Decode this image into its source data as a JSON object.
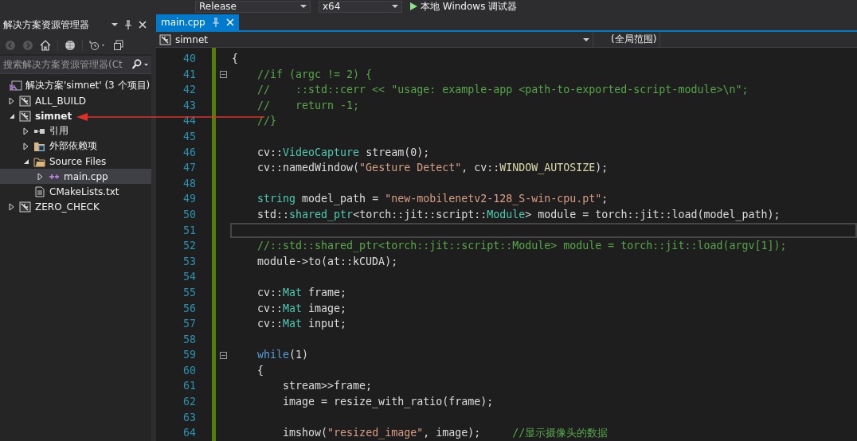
{
  "toolbar": {
    "configuration": "Release",
    "platform": "x64",
    "debugger": "本地 Windows 调试器"
  },
  "solution_explorer": {
    "title": "解决方案资源管理器",
    "search": {
      "placeholder": "搜索解决方案资源管理器(Ct"
    },
    "tree": [
      {
        "label": "解决方案'simnet' (3 个项目)",
        "kind": "solution",
        "selected": false,
        "bold": false,
        "children": [
          {
            "label": "ALL_BUILD",
            "kind": "project",
            "expanded": false,
            "selected": false,
            "bold": false
          },
          {
            "label": "simnet",
            "kind": "project",
            "expanded": true,
            "selected": false,
            "bold": true,
            "children": [
              {
                "label": "引用",
                "kind": "references",
                "expanded": false,
                "selected": false,
                "bold": false
              },
              {
                "label": "外部依赖项",
                "kind": "dependencies",
                "expanded": false,
                "selected": false,
                "bold": false
              },
              {
                "label": "Source Files",
                "kind": "filter",
                "expanded": true,
                "selected": false,
                "bold": false,
                "children": [
                  {
                    "label": "main.cpp",
                    "kind": "cpp",
                    "expanded": false,
                    "selected": true,
                    "bold": false
                  }
                ]
              },
              {
                "label": "CMakeLists.txt",
                "kind": "text",
                "selected": false,
                "bold": false
              }
            ]
          },
          {
            "label": "ZERO_CHECK",
            "kind": "project",
            "expanded": false,
            "selected": false,
            "bold": false
          }
        ]
      }
    ]
  },
  "editor": {
    "tabs": [
      {
        "label": "main.cpp",
        "selected": true
      }
    ],
    "project": "simnet",
    "scope": "(全局范围)",
    "lines": [
      {
        "number": "40",
        "current": false,
        "foldable": false,
        "tokens": [
          {
            "kind": "plain",
            "text": "{"
          }
        ]
      },
      {
        "number": "41",
        "current": false,
        "foldable": true,
        "tokens": [
          {
            "kind": "comment",
            "text": "    //if (argc != 2) {"
          }
        ]
      },
      {
        "number": "42",
        "current": false,
        "foldable": false,
        "tokens": [
          {
            "kind": "comment",
            "text": "    //    ::std::cerr << \"usage: example-app <path-to-exported-script-module>\\n\";"
          }
        ]
      },
      {
        "number": "43",
        "current": false,
        "foldable": false,
        "tokens": [
          {
            "kind": "comment",
            "text": "    //    return -1;"
          }
        ]
      },
      {
        "number": "44",
        "current": false,
        "foldable": false,
        "tokens": [
          {
            "kind": "comment",
            "text": "    //}"
          }
        ]
      },
      {
        "number": "45",
        "current": false,
        "foldable": false
      },
      {
        "number": "46",
        "current": false,
        "foldable": false,
        "tokens": [
          {
            "kind": "plain",
            "text": "    cv::"
          },
          {
            "kind": "type",
            "text": "VideoCapture"
          },
          {
            "kind": "plain",
            "text": " stream(0);"
          }
        ]
      },
      {
        "number": "47",
        "current": false,
        "foldable": false,
        "tokens": [
          {
            "kind": "plain",
            "text": "    cv::namedWindow("
          },
          {
            "kind": "string",
            "text": "\"Gesture Detect\""
          },
          {
            "kind": "plain",
            "text": ", cv::"
          },
          {
            "kind": "macro",
            "text": "WINDOW_AUTOSIZE"
          },
          {
            "kind": "plain",
            "text": ");"
          }
        ]
      },
      {
        "number": "48",
        "current": false,
        "foldable": false
      },
      {
        "number": "49",
        "current": false,
        "foldable": false,
        "tokens": [
          {
            "kind": "type",
            "text": "    string"
          },
          {
            "kind": "plain",
            "text": " model_path = "
          },
          {
            "kind": "string",
            "text": "\"new-mobilenetv2-128_S-win-cpu.pt\""
          },
          {
            "kind": "plain",
            "text": ";"
          }
        ]
      },
      {
        "number": "50",
        "current": false,
        "foldable": false,
        "tokens": [
          {
            "kind": "plain",
            "text": "    std::"
          },
          {
            "kind": "type",
            "text": "shared_ptr"
          },
          {
            "kind": "plain",
            "text": "<torch::jit::script::"
          },
          {
            "kind": "type",
            "text": "Module"
          },
          {
            "kind": "plain",
            "text": "> module = torch::jit::load(model_path);"
          }
        ]
      },
      {
        "number": "51",
        "current": true,
        "foldable": false
      },
      {
        "number": "52",
        "current": false,
        "foldable": false,
        "tokens": [
          {
            "kind": "comment",
            "text": "    //::std::shared_ptr<torch::jit::script::Module> module = torch::jit::load(argv[1]);"
          }
        ]
      },
      {
        "number": "53",
        "current": false,
        "foldable": false,
        "tokens": [
          {
            "kind": "plain",
            "text": "    module->to(at::kCUDA);"
          }
        ]
      },
      {
        "number": "54",
        "current": false,
        "foldable": false
      },
      {
        "number": "55",
        "current": false,
        "foldable": false,
        "tokens": [
          {
            "kind": "plain",
            "text": "    cv::"
          },
          {
            "kind": "type",
            "text": "Mat"
          },
          {
            "kind": "plain",
            "text": " frame;"
          }
        ]
      },
      {
        "number": "56",
        "current": false,
        "foldable": false,
        "tokens": [
          {
            "kind": "plain",
            "text": "    cv::"
          },
          {
            "kind": "type",
            "text": "Mat"
          },
          {
            "kind": "plain",
            "text": " image;"
          }
        ]
      },
      {
        "number": "57",
        "current": false,
        "foldable": false,
        "tokens": [
          {
            "kind": "plain",
            "text": "    cv::"
          },
          {
            "kind": "type",
            "text": "Mat"
          },
          {
            "kind": "plain",
            "text": " input;"
          }
        ]
      },
      {
        "number": "58",
        "current": false,
        "foldable": false
      },
      {
        "number": "59",
        "current": false,
        "foldable": true,
        "tokens": [
          {
            "kind": "keyword",
            "text": "    while"
          },
          {
            "kind": "plain",
            "text": "(1)"
          }
        ]
      },
      {
        "number": "60",
        "current": false,
        "foldable": false,
        "tokens": [
          {
            "kind": "plain",
            "text": "    {"
          }
        ]
      },
      {
        "number": "61",
        "current": false,
        "foldable": false,
        "tokens": [
          {
            "kind": "plain",
            "text": "        stream>>frame;"
          }
        ]
      },
      {
        "number": "62",
        "current": false,
        "foldable": false,
        "tokens": [
          {
            "kind": "plain",
            "text": "        image = resize_with_ratio(frame);"
          }
        ]
      },
      {
        "number": "63",
        "current": false,
        "foldable": false
      },
      {
        "number": "64",
        "current": false,
        "foldable": false,
        "tokens": [
          {
            "kind": "plain",
            "text": "        imshow("
          },
          {
            "kind": "string",
            "text": "\"resized_image\""
          },
          {
            "kind": "plain",
            "text": ", image);     "
          },
          {
            "kind": "comment",
            "text": "//显示摄像头的数据"
          }
        ]
      }
    ]
  }
}
